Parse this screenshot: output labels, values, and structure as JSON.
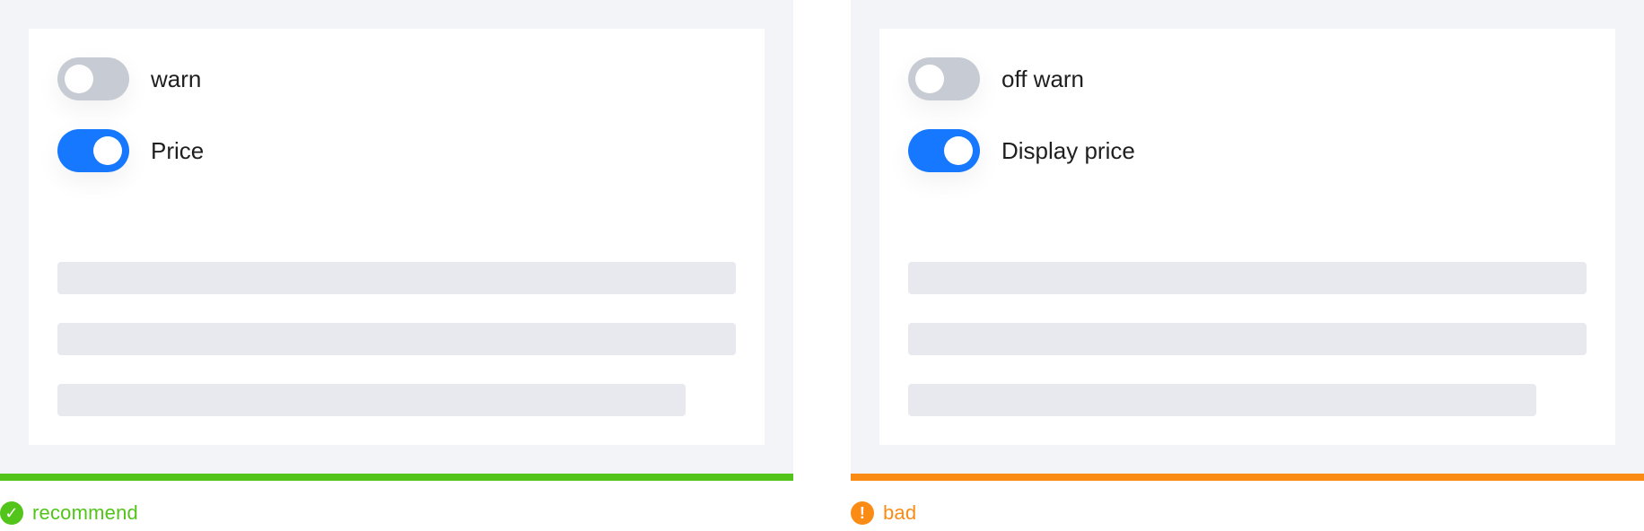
{
  "examples": [
    {
      "caption": "recommend",
      "status": "good",
      "status_icon": "check-circle-icon",
      "accent_color": "#52c41a",
      "toggles": [
        {
          "label": "warn",
          "state": "off"
        },
        {
          "label": "Price",
          "state": "on"
        }
      ]
    },
    {
      "caption": "bad",
      "status": "bad",
      "status_icon": "exclamation-circle-icon",
      "accent_color": "#fa8c16",
      "toggles": [
        {
          "label": "off warn",
          "state": "off"
        },
        {
          "label": "Display price",
          "state": "on"
        }
      ]
    }
  ],
  "colors": {
    "frame_background": "#f3f4f7",
    "card_background": "#ffffff",
    "toggle_on": "#1677ff",
    "toggle_off": "#c7cbd3",
    "placeholder": "#e7e9ef",
    "text": "#1f1f1f"
  },
  "icons": {
    "success": "check-circle-icon",
    "warning": "exclamation-circle-icon"
  }
}
